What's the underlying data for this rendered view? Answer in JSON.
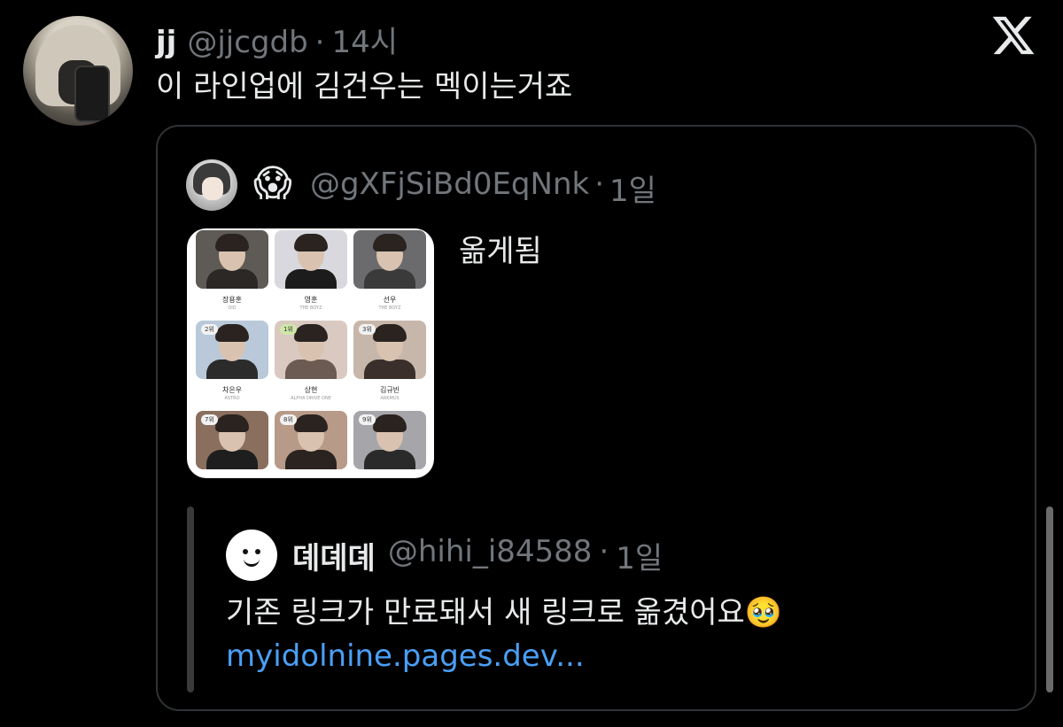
{
  "tweet": {
    "display_name": "jj",
    "handle": "@jjcgdb",
    "separator": "·",
    "time": "14시",
    "text": "이 라인업에 김건우는 멕이는거죠"
  },
  "brand": {
    "logo_icon": "x-logo-icon"
  },
  "quote": {
    "emoji": "😱",
    "handle": "@gXFjSiBd0EqNnk",
    "separator": "·",
    "time": "1일",
    "text": "옮게됨",
    "image_grid": [
      {
        "name": "장용훈",
        "group": "OID",
        "rank": ""
      },
      {
        "name": "영훈",
        "group": "THE BOYZ",
        "rank": ""
      },
      {
        "name": "선우",
        "group": "THE BOYZ",
        "rank": ""
      },
      {
        "name": "차은우",
        "group": "ASTRO",
        "rank": "2위"
      },
      {
        "name": "상현",
        "group": "ALPHA DRIVE ONE",
        "rank": "1위"
      },
      {
        "name": "김규빈",
        "group": "ARKMUS",
        "rank": "3위"
      },
      {
        "name": "",
        "group": "",
        "rank": "7위"
      },
      {
        "name": "",
        "group": "",
        "rank": "8위"
      },
      {
        "name": "",
        "group": "",
        "rank": "9위"
      }
    ]
  },
  "nested_quote": {
    "display_name": "뎨뎨뎨",
    "handle": "@hihi_i84588",
    "separator": "·",
    "time": "1일",
    "text": "기존 링크가 만료돼서 새 링크로 옮겼어요🥹",
    "link": "myidolnine.pages.dev..."
  },
  "colors": {
    "background": "#000000",
    "text": "#e7e9ea",
    "muted": "#71767b",
    "link": "#4a9ff5",
    "border": "#2f3336"
  }
}
